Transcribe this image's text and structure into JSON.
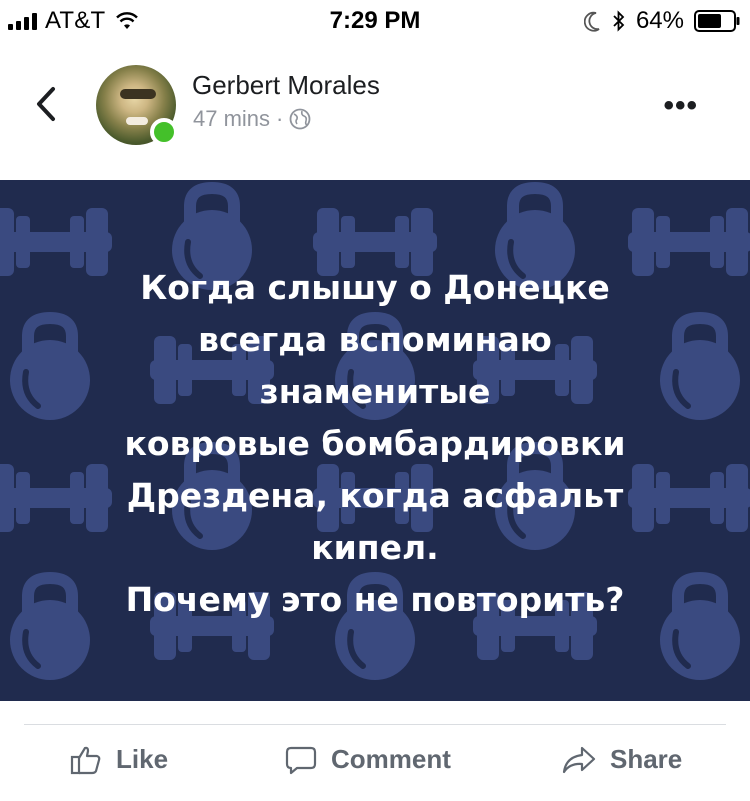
{
  "status_bar": {
    "carrier": "AT&T",
    "time": "7:29 PM",
    "battery": "64%",
    "icons": [
      "signal-icon",
      "wifi-icon",
      "moon-icon",
      "bluetooth-icon",
      "battery-icon"
    ]
  },
  "post": {
    "author": "Gerbert Morales",
    "time_ago": "47 mins",
    "separator": "·",
    "privacy_icon": "globe-icon",
    "more_label": "•••",
    "online": true,
    "image_text": [
      "Когда слышу о Донецке",
      "всегда вспоминаю",
      "знаменитые",
      "ковровые бомбардировки",
      "Дрездена, когда асфальт",
      "кипел.",
      "Почему это не повторить?"
    ],
    "image_background": "#202b4e",
    "pattern_color": "#3a4a80"
  },
  "actions": {
    "like": "Like",
    "comment": "Comment",
    "share": "Share"
  }
}
